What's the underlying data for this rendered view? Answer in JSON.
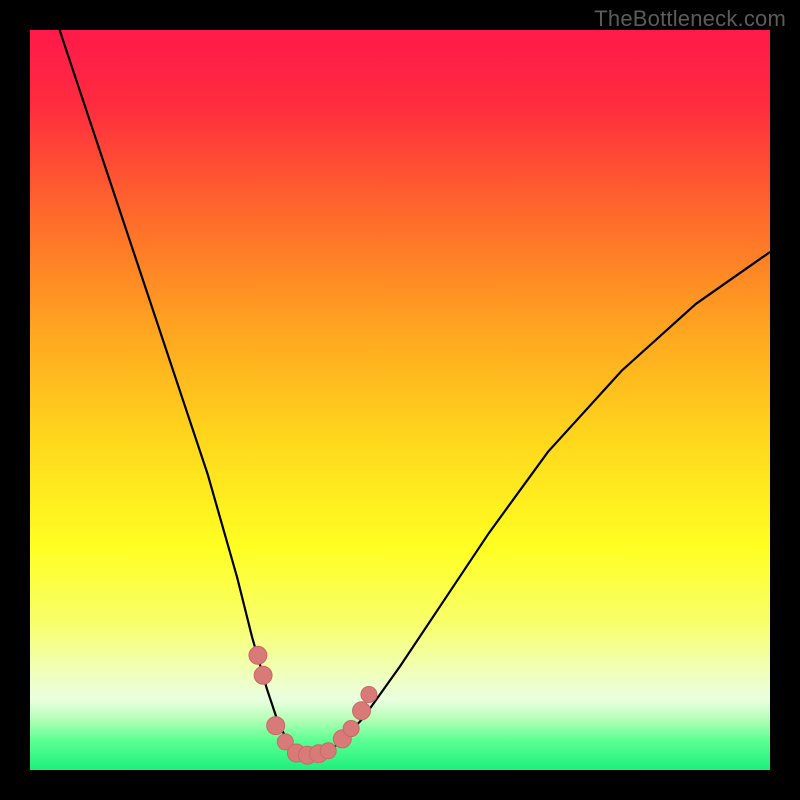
{
  "watermark": "TheBottleneck.com",
  "colors": {
    "frame": "#000000",
    "curve": "#000000",
    "marker_fill": "#d87a78",
    "marker_stroke": "#c96966",
    "gradient_stops": [
      {
        "offset": 0.0,
        "color": "#ff1a4a"
      },
      {
        "offset": 0.1,
        "color": "#ff2b3f"
      },
      {
        "offset": 0.25,
        "color": "#ff6a2b"
      },
      {
        "offset": 0.4,
        "color": "#ffa320"
      },
      {
        "offset": 0.55,
        "color": "#ffd61c"
      },
      {
        "offset": 0.7,
        "color": "#ffff22"
      },
      {
        "offset": 0.8,
        "color": "#f8ff6a"
      },
      {
        "offset": 0.86,
        "color": "#f1ffb0"
      },
      {
        "offset": 0.905,
        "color": "#e9ffe0"
      },
      {
        "offset": 0.93,
        "color": "#b8ffb8"
      },
      {
        "offset": 0.96,
        "color": "#5cff92"
      },
      {
        "offset": 1.0,
        "color": "#1cf07e"
      }
    ]
  },
  "chart_data": {
    "type": "line",
    "title": "",
    "xlabel": "",
    "ylabel": "",
    "xlim": [
      0,
      100
    ],
    "ylim": [
      0,
      100
    ],
    "grid": false,
    "series": [
      {
        "name": "bottleneck-curve",
        "x": [
          4,
          8,
          12,
          16,
          20,
          24,
          28,
          30,
          32,
          33.5,
          35,
          36.5,
          38,
          40,
          42,
          45,
          50,
          56,
          62,
          70,
          80,
          90,
          100
        ],
        "values": [
          100,
          88,
          76,
          64,
          52,
          40,
          26,
          18,
          11,
          6.5,
          3.5,
          2.2,
          2.0,
          2.3,
          3.8,
          7,
          14,
          23,
          32,
          43,
          54,
          63,
          70
        ]
      }
    ],
    "markers": {
      "name": "highlighted-points",
      "x": [
        30.8,
        31.5,
        33.2,
        34.5,
        36.0,
        37.5,
        39.0,
        40.3,
        42.2,
        43.4,
        44.8,
        45.8
      ],
      "values": [
        15.5,
        12.8,
        6.0,
        3.8,
        2.3,
        2.0,
        2.2,
        2.6,
        4.2,
        5.6,
        8.0,
        10.2
      ],
      "radius": [
        9,
        9,
        9,
        8,
        9,
        9,
        9,
        8,
        9,
        8,
        9,
        8
      ]
    }
  }
}
